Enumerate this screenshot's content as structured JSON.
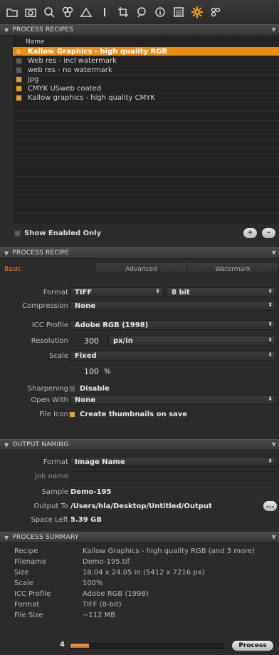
{
  "toolbar": {
    "icons": [
      "folder-icon",
      "camera-icon",
      "search-icon",
      "layers-icon",
      "triangle-icon",
      "exposure-icon",
      "crop-icon",
      "adjust-icon",
      "info-icon",
      "list-icon",
      "gear-icon",
      "process-icon"
    ],
    "active_color": "#f09a20"
  },
  "process_recipes": {
    "header": "PROCESS RECIPES",
    "column_name": "Name",
    "items": [
      {
        "label": "Kallow Graphics - high quality RGB",
        "checked": true,
        "selected": true
      },
      {
        "label": "Web res - incl watermark",
        "checked": false,
        "selected": false
      },
      {
        "label": "web res - no watermark",
        "checked": false,
        "selected": false
      },
      {
        "label": "jpg",
        "checked": true,
        "selected": false
      },
      {
        "label": "CMYK USweb coated",
        "checked": true,
        "selected": false
      },
      {
        "label": "Kallow graphics - high quality CMYK",
        "checked": true,
        "selected": false
      }
    ],
    "show_enabled_label": "Show Enabled Only",
    "add_label": "+",
    "remove_label": "-"
  },
  "process_recipe": {
    "header": "PROCESS RECIPE",
    "tabs": {
      "basic": "Basic",
      "advanced": "Advanced",
      "watermark": "Watermark"
    },
    "format_label": "Format",
    "format_value": "TIFF",
    "bit_depth": "8 bit",
    "compression_label": "Compression",
    "compression_value": "None",
    "icc_label": "ICC Profile",
    "icc_value": "Adobe RGB (1998)",
    "resolution_label": "Resolution",
    "resolution_value": "300",
    "resolution_unit": "px/in",
    "scale_label": "Scale",
    "scale_value": "Fixed",
    "scale_percent": "100",
    "scale_percent_unit": "%",
    "sharpening_label": "Sharpening",
    "sharpening_value": "Disable",
    "open_with_label": "Open With",
    "open_with_value": "None",
    "file_icon_label": "File Icon",
    "file_icon_value": "Create thumbnails on save"
  },
  "output_naming": {
    "header": "OUTPUT NAMING",
    "format_label": "Format",
    "format_value": "Image Name",
    "job_name_label": "Job name",
    "job_name_value": "",
    "sample_label": "Sample",
    "sample_value": "Demo-195",
    "output_to_label": "Output To",
    "output_to_value": "/Users/hla/Desktop/Untitled/Output",
    "browse_label": "...",
    "space_left_label": "Space Left",
    "space_left_value": "5.39 GB"
  },
  "process_summary": {
    "header": "PROCESS SUMMARY",
    "rows": [
      {
        "key": "Recipe",
        "value": "Kallow Graphics - high quality RGB (and 3 more)"
      },
      {
        "key": "Filename",
        "value": "Demo-195.tif"
      },
      {
        "key": "Size",
        "value": "18,04 x 24,05 in (5412 x 7216 px)"
      },
      {
        "key": "Scale",
        "value": "100%"
      },
      {
        "key": "ICC Profile",
        "value": "Adobe RGB (1998)"
      },
      {
        "key": "Format",
        "value": "TIFF (8-bit)"
      },
      {
        "key": "File Size",
        "value": "~112 MB"
      }
    ],
    "queue_count": "4",
    "progress": 0.12,
    "process_label": "Process"
  }
}
